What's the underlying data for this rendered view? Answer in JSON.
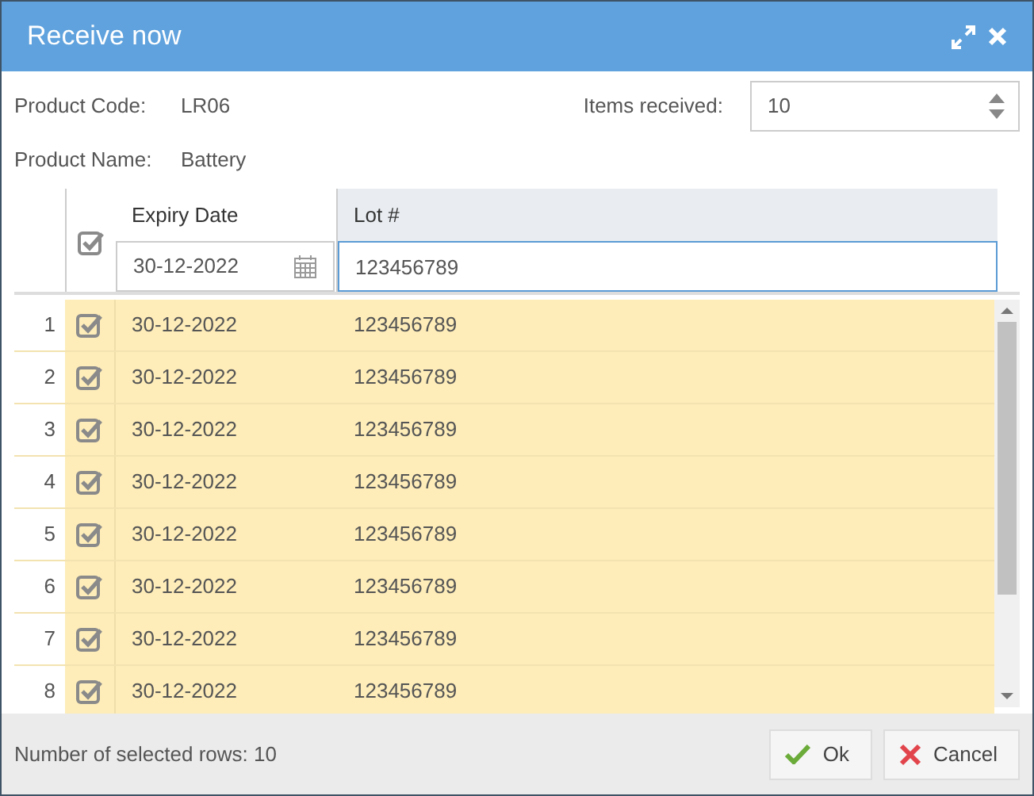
{
  "window": {
    "title": "Receive now"
  },
  "product_code": {
    "label": "Product Code:",
    "value": "LR06"
  },
  "product_name": {
    "label": "Product Name:",
    "value": "Battery"
  },
  "items_received": {
    "label": "Items received:",
    "value": "10"
  },
  "table": {
    "select_all_checked": true,
    "columns": [
      "Expiry Date",
      "Lot #"
    ],
    "filters": {
      "expiry_date": "30-12-2022",
      "lot": "123456789"
    },
    "rows": [
      {
        "number": "1",
        "checked": true,
        "expiry_date": "30-12-2022",
        "lot": "123456789"
      },
      {
        "number": "2",
        "checked": true,
        "expiry_date": "30-12-2022",
        "lot": "123456789"
      },
      {
        "number": "3",
        "checked": true,
        "expiry_date": "30-12-2022",
        "lot": "123456789"
      },
      {
        "number": "4",
        "checked": true,
        "expiry_date": "30-12-2022",
        "lot": "123456789"
      },
      {
        "number": "5",
        "checked": true,
        "expiry_date": "30-12-2022",
        "lot": "123456789"
      },
      {
        "number": "6",
        "checked": true,
        "expiry_date": "30-12-2022",
        "lot": "123456789"
      },
      {
        "number": "7",
        "checked": true,
        "expiry_date": "30-12-2022",
        "lot": "123456789"
      },
      {
        "number": "8",
        "checked": true,
        "expiry_date": "30-12-2022",
        "lot": "123456789"
      }
    ]
  },
  "status_bar": {
    "text": "Number of selected rows: 10"
  },
  "buttons": [
    {
      "kind": "ok",
      "label": "Ok"
    },
    {
      "kind": "cancel",
      "label": "Cancel"
    }
  ]
}
